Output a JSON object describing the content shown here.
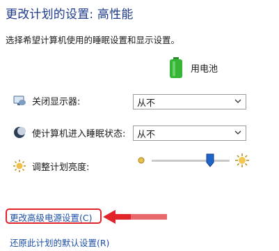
{
  "title": "更改计划的设置: 高性能",
  "subtitle": "选择希望计算机使用的睡眠设置和显示设置。",
  "column_header": {
    "label": "用电池",
    "icon": "battery-icon"
  },
  "settings": {
    "display_off": {
      "label": "关闭显示器:",
      "icon": "monitor-icon",
      "value": "从不"
    },
    "sleep": {
      "label": "使计算机进入睡眠状态:",
      "icon": "sleep-moon-icon",
      "value": "从不"
    },
    "brightness": {
      "label": "调整计划亮度:",
      "icon": "brightness-sun-icon",
      "level_percent": 75
    }
  },
  "links": {
    "advanced": "更改高级电源设置(C)",
    "restore": "还原此计划的默认设置(R)"
  },
  "colors": {
    "title": "#1e3b8a",
    "link": "#1c4fa8",
    "highlight": "#e0242a",
    "battery": "#2fae2f",
    "slider_thumb": "#1f64c8"
  }
}
